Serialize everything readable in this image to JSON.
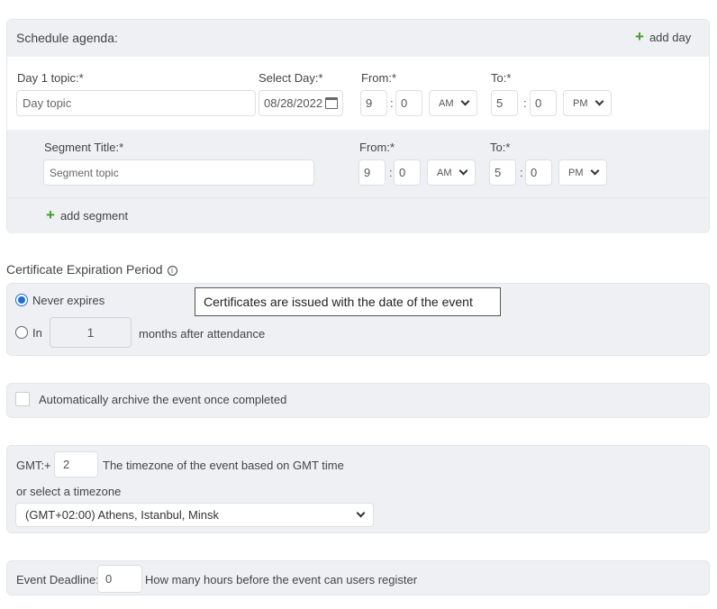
{
  "schedule": {
    "title": "Schedule agenda:",
    "add_day": "add day",
    "day": {
      "topic_label": "Day 1 topic:*",
      "topic_placeholder": "Day topic",
      "select_day_label": "Select Day:*",
      "select_day_value": "08/28/2022",
      "from_label": "From:*",
      "from_hour": "9",
      "from_min": "0",
      "from_ampm": "AM",
      "to_label": "To:*",
      "to_hour": "5",
      "to_min": "0",
      "to_ampm": "PM"
    },
    "segment": {
      "title_label": "Segment Title:*",
      "title_placeholder": "Segment topic",
      "from_label": "From:*",
      "from_hour": "9",
      "from_min": "0",
      "from_ampm": "AM",
      "to_label": "To:*",
      "to_hour": "5",
      "to_min": "0",
      "to_ampm": "PM"
    },
    "add_segment": "add segment",
    "colon": ":"
  },
  "certificate": {
    "heading": "Certificate Expiration Period",
    "tooltip": "Certificates are issued with the date of the event",
    "never_label": "Never expires",
    "in_label": "In",
    "months_value": "1",
    "months_after": "months after attendance",
    "selected": "never"
  },
  "archive": {
    "label": "Automatically archive the event once completed",
    "checked": false
  },
  "timezone": {
    "gmt_prefix": "GMT:+",
    "gmt_value": "2",
    "gmt_desc": "The timezone of the event based on GMT time",
    "or_select": "or select a timezone",
    "selected": "(GMT+02:00) Athens, Istanbul, Minsk"
  },
  "deadline": {
    "label": "Event Deadline:",
    "value": "0",
    "desc": "How many hours before the event can users register"
  }
}
